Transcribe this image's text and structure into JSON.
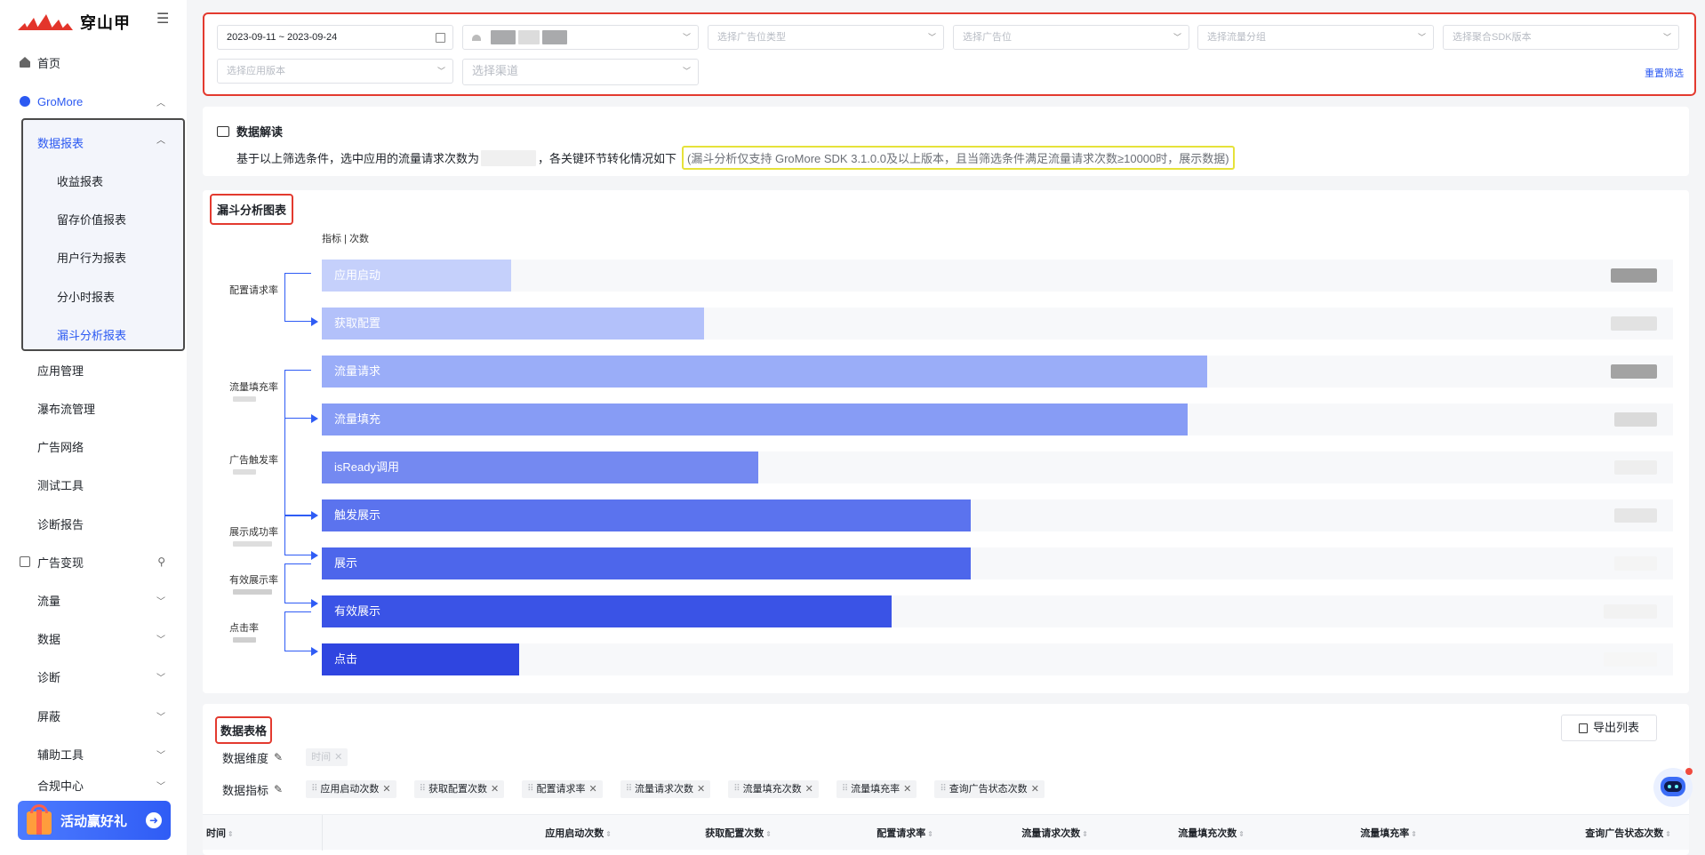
{
  "brand": {
    "name": "穿山甲"
  },
  "sidebar": {
    "home": "首页",
    "gromore": "GroMore",
    "data_report": "数据报表",
    "sub_items": [
      "收益报表",
      "留存价值报表",
      "用户行为报表",
      "分小时报表",
      "漏斗分析报表"
    ],
    "active_sub": "漏斗分析报表",
    "gromore_items": [
      "应用管理",
      "瀑布流管理",
      "广告网络",
      "测试工具",
      "诊断报告"
    ],
    "ad_monetize": "广告变现",
    "monetize_items": [
      "流量",
      "数据",
      "诊断",
      "屏蔽",
      "辅助工具",
      "合规中心"
    ],
    "promo": "活动赢好礼"
  },
  "filters": {
    "date_range": "2023-09-11 ~ 2023-09-24",
    "ad_slot_type_placeholder": "选择广告位类型",
    "ad_slot_placeholder": "选择广告位",
    "traffic_group_placeholder": "选择流量分组",
    "sdk_version_placeholder": "选择聚合SDK版本",
    "app_version_placeholder": "选择应用版本",
    "channel_placeholder": "选择渠道",
    "reset": "重置筛选"
  },
  "insight": {
    "title": "数据解读",
    "text_prefix": "基于以上筛选条件，选中应用的流量请求次数为",
    "text_suffix": "，各关键环节转化情况如下",
    "note": "(漏斗分析仅支持 GroMore SDK 3.1.0.0及以上版本，且当筛选条件满足流量请求次数≥10000时，展示数据)"
  },
  "funnel": {
    "title": "漏斗分析图表",
    "legend": "指标  |  次数",
    "rates": [
      "配置请求率",
      "流量填充率",
      "广告触发率",
      "展示成功率",
      "有效展示率",
      "点击率"
    ],
    "colors": [
      "#c5d0fb",
      "#b3c1fa",
      "#9aadf8",
      "#879cf5",
      "#7489f1",
      "#5b73ee",
      "#4d66eb",
      "#3a53e6",
      "#2f45e0"
    ]
  },
  "chart_data": {
    "type": "bar",
    "title": "漏斗分析图表",
    "categories": [
      "应用启动",
      "获取配置",
      "流量请求",
      "流量填充",
      "isReady调用",
      "触发展示",
      "展示",
      "有效展示",
      "点击"
    ],
    "values": [
      0.14,
      0.283,
      0.655,
      0.641,
      0.323,
      0.48,
      0.48,
      0.422,
      0.146
    ],
    "xlabel": "",
    "ylabel": ""
  },
  "table": {
    "title": "数据表格",
    "export": "导出列表",
    "dimension_label": "数据维度",
    "dimension_tags": [
      "时间"
    ],
    "metric_label": "数据指标",
    "metric_tags": [
      "应用启动次数",
      "获取配置次数",
      "配置请求率",
      "流量请求次数",
      "流量填充次数",
      "流量填充率",
      "查询广告状态次数"
    ],
    "columns": [
      "时间",
      "应用启动次数",
      "获取配置次数",
      "配置请求率",
      "流量请求次数",
      "流量填充次数",
      "流量填充率",
      "查询广告状态次数"
    ]
  }
}
